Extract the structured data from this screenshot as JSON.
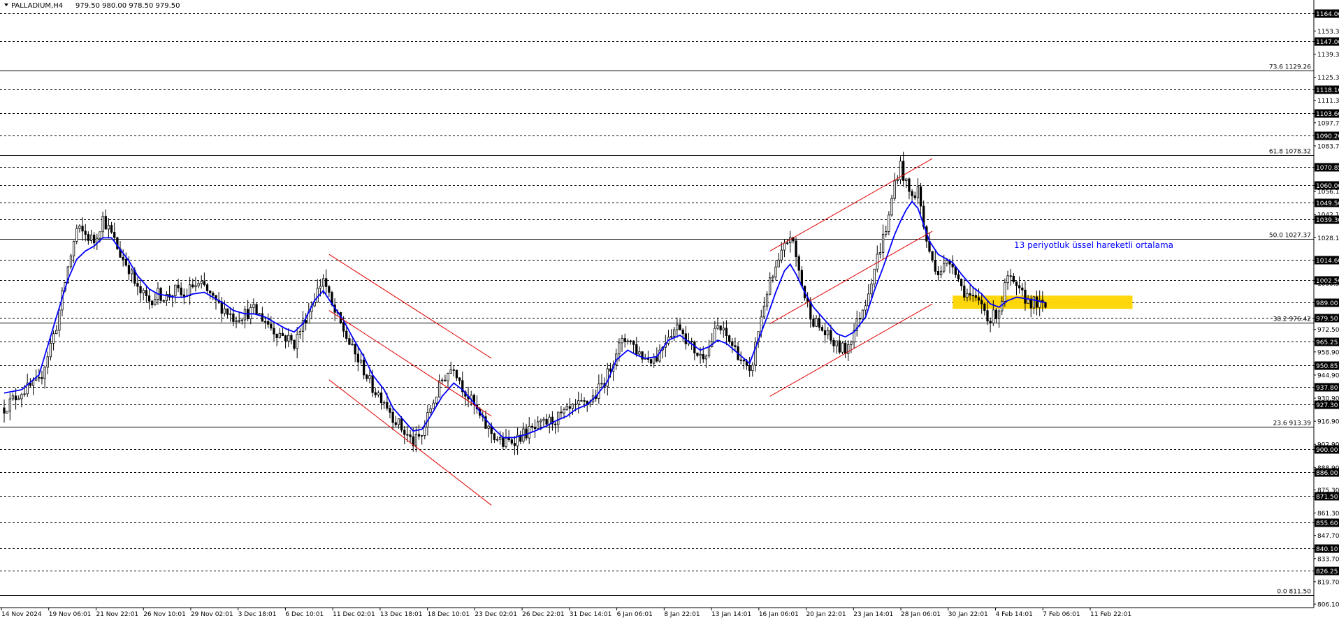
{
  "header": {
    "symbol": "PALLADIUM,H4",
    "ohlc": "979.50 980.00 978.50 979.50"
  },
  "annotation": {
    "ema_label": "13 periyotluk üssel hareketli ortalama"
  },
  "colors": {
    "ema": "#0000ff",
    "candle": "#000000",
    "channel": "#e00000",
    "zone": "#ffd500",
    "background": "#ffffff"
  },
  "chart_data": {
    "type": "candlestick",
    "instrument": "PALLADIUM",
    "timeframe": "H4",
    "ylim": [
      806.1,
      1167.0
    ],
    "y_tick_labels": [
      "1153.30",
      "1139.30",
      "1125.30",
      "1111.30",
      "1097.70",
      "1083.70",
      "1056.10",
      "1042.10",
      "1028.10",
      "1000.50",
      "972.50",
      "958.90",
      "944.90",
      "930.90",
      "916.90",
      "902.90",
      "888.90",
      "875.30",
      "861.30",
      "847.70",
      "833.70",
      "819.70",
      "806.10"
    ],
    "x_tick_labels": [
      "14 Nov 2024",
      "19 Nov 06:01",
      "21 Nov 22:01",
      "26 Nov 10:01",
      "29 Nov 02:01",
      "3 Dec 18:01",
      "6 Dec 10:01",
      "11 Dec 02:01",
      "13 Dec 18:01",
      "18 Dec 10:01",
      "23 Dec 02:01",
      "26 Dec 22:01",
      "31 Dec 14:01",
      "6 Jan 06:01",
      "8 Jan 22:01",
      "13 Jan 14:01",
      "16 Jan 06:01",
      "20 Jan 22:01",
      "23 Jan 14:01",
      "28 Jan 06:01",
      "30 Jan 22:01",
      "4 Feb 14:01",
      "7 Feb 06:01",
      "11 Feb 22:01"
    ],
    "levels": [
      {
        "label": "1164.00",
        "value": 1164.0,
        "boxed": true
      },
      {
        "label": "1147.00",
        "value": 1147.0,
        "boxed": true
      },
      {
        "label": "1118.10",
        "value": 1118.1,
        "boxed": true
      },
      {
        "label": "1103.60",
        "value": 1103.6,
        "boxed": true
      },
      {
        "label": "1090.20",
        "value": 1090.2,
        "boxed": true
      },
      {
        "label": "1070.85",
        "value": 1070.85,
        "boxed": true
      },
      {
        "label": "1060.00",
        "value": 1060.0,
        "boxed": true
      },
      {
        "label": "1049.50",
        "value": 1049.5,
        "boxed": true
      },
      {
        "label": "1039.30",
        "value": 1039.3,
        "boxed": true
      },
      {
        "label": "1014.60",
        "value": 1014.6,
        "boxed": true
      },
      {
        "label": "1002.50",
        "value": 1002.5,
        "boxed": true
      },
      {
        "label": "989.00",
        "value": 989.0,
        "boxed": true
      },
      {
        "label": "979.50",
        "value": 979.5,
        "boxed": true
      },
      {
        "label": "965.25",
        "value": 965.25,
        "boxed": true
      },
      {
        "label": "950.85",
        "value": 950.85,
        "boxed": true
      },
      {
        "label": "937.80",
        "value": 937.8,
        "boxed": true
      },
      {
        "label": "927.30",
        "value": 927.3,
        "boxed": true
      },
      {
        "label": "900.00",
        "value": 900.0,
        "boxed": true
      },
      {
        "label": "886.00",
        "value": 886.0,
        "boxed": true
      },
      {
        "label": "871.50",
        "value": 871.5,
        "boxed": true
      },
      {
        "label": "855.60",
        "value": 855.6,
        "boxed": true
      },
      {
        "label": "840.10",
        "value": 840.1,
        "boxed": true
      },
      {
        "label": "826.25",
        "value": 826.25,
        "boxed": true
      }
    ],
    "fibonacci": [
      {
        "label": "73.6 1129.26",
        "value": 1129.26
      },
      {
        "label": "61.8 1078.32",
        "value": 1078.32
      },
      {
        "label": "50.0 1027.37",
        "value": 1027.37
      },
      {
        "label": "38.2 976.42",
        "value": 976.42
      },
      {
        "label": "23.6 913.39",
        "value": 913.39
      },
      {
        "label": "0.0 811.50",
        "value": 811.5
      }
    ],
    "price_path": [
      [
        0,
        925
      ],
      [
        6,
        935
      ],
      [
        12,
        940
      ],
      [
        18,
        975
      ],
      [
        22,
        1010
      ],
      [
        25,
        1033
      ],
      [
        28,
        1030
      ],
      [
        31,
        1026
      ],
      [
        34,
        1040
      ],
      [
        37,
        1030
      ],
      [
        40,
        1018
      ],
      [
        43,
        1010
      ],
      [
        46,
        996
      ],
      [
        50,
        990
      ],
      [
        53,
        994
      ],
      [
        56,
        992
      ],
      [
        59,
        996
      ],
      [
        62,
        992
      ],
      [
        65,
        999
      ],
      [
        69,
        998
      ],
      [
        72,
        990
      ],
      [
        76,
        985
      ],
      [
        79,
        980
      ],
      [
        83,
        982
      ],
      [
        86,
        984
      ],
      [
        90,
        978
      ],
      [
        93,
        972
      ],
      [
        97,
        968
      ],
      [
        100,
        964
      ],
      [
        103,
        976
      ],
      [
        107,
        992
      ],
      [
        110,
        1004
      ],
      [
        113,
        986
      ],
      [
        117,
        972
      ],
      [
        120,
        960
      ],
      [
        124,
        948
      ],
      [
        127,
        937
      ],
      [
        131,
        930
      ],
      [
        134,
        920
      ],
      [
        138,
        910
      ],
      [
        141,
        904
      ],
      [
        144,
        908
      ],
      [
        147,
        925
      ],
      [
        151,
        942
      ],
      [
        155,
        951
      ],
      [
        158,
        938
      ],
      [
        162,
        926
      ],
      [
        165,
        916
      ],
      [
        169,
        908
      ],
      [
        172,
        903
      ],
      [
        176,
        906
      ],
      [
        180,
        910
      ],
      [
        183,
        912
      ],
      [
        187,
        916
      ],
      [
        190,
        918
      ],
      [
        194,
        922
      ],
      [
        197,
        925
      ],
      [
        201,
        928
      ],
      [
        204,
        933
      ],
      [
        208,
        945
      ],
      [
        211,
        960
      ],
      [
        215,
        968
      ],
      [
        218,
        960
      ],
      [
        221,
        955
      ],
      [
        225,
        956
      ],
      [
        229,
        970
      ],
      [
        233,
        975
      ],
      [
        236,
        964
      ],
      [
        240,
        956
      ],
      [
        243,
        962
      ],
      [
        246,
        974
      ],
      [
        249,
        968
      ],
      [
        253,
        958
      ],
      [
        257,
        944
      ],
      [
        260,
        972
      ],
      [
        263,
        996
      ],
      [
        266,
        1008
      ],
      [
        269,
        1022
      ],
      [
        271,
        1030
      ],
      [
        273,
        1016
      ],
      [
        276,
        992
      ],
      [
        279,
        978
      ],
      [
        283,
        970
      ],
      [
        287,
        962
      ],
      [
        290,
        960
      ],
      [
        293,
        972
      ],
      [
        297,
        990
      ],
      [
        300,
        1010
      ],
      [
        303,
        1028
      ],
      [
        305,
        1040
      ],
      [
        307,
        1062
      ],
      [
        309,
        1072
      ],
      [
        311,
        1060
      ],
      [
        313,
        1052
      ],
      [
        315,
        1058
      ],
      [
        317,
        1035
      ],
      [
        319,
        1018
      ],
      [
        322,
        1008
      ],
      [
        325,
        1012
      ],
      [
        327,
        1014
      ],
      [
        330,
        998
      ],
      [
        334,
        990
      ],
      [
        337,
        988
      ],
      [
        340,
        978
      ],
      [
        343,
        985
      ],
      [
        346,
        1004
      ],
      [
        349,
        996
      ],
      [
        353,
        990
      ],
      [
        356,
        988
      ],
      [
        358,
        986
      ]
    ],
    "ema13_path": [
      [
        0,
        934
      ],
      [
        6,
        936
      ],
      [
        12,
        945
      ],
      [
        18,
        980
      ],
      [
        22,
        1003
      ],
      [
        25,
        1015
      ],
      [
        28,
        1020
      ],
      [
        31,
        1023
      ],
      [
        34,
        1028
      ],
      [
        37,
        1028
      ],
      [
        40,
        1021
      ],
      [
        43,
        1014
      ],
      [
        46,
        1005
      ],
      [
        50,
        997
      ],
      [
        53,
        994
      ],
      [
        56,
        993
      ],
      [
        59,
        992
      ],
      [
        62,
        992
      ],
      [
        65,
        994
      ],
      [
        69,
        995
      ],
      [
        72,
        992
      ],
      [
        76,
        988
      ],
      [
        79,
        984
      ],
      [
        83,
        982
      ],
      [
        86,
        982
      ],
      [
        90,
        980
      ],
      [
        93,
        977
      ],
      [
        97,
        973
      ],
      [
        100,
        971
      ],
      [
        103,
        976
      ],
      [
        107,
        990
      ],
      [
        110,
        996
      ],
      [
        113,
        988
      ],
      [
        117,
        978
      ],
      [
        120,
        968
      ],
      [
        124,
        956
      ],
      [
        127,
        945
      ],
      [
        131,
        936
      ],
      [
        134,
        925
      ],
      [
        138,
        917
      ],
      [
        141,
        911
      ],
      [
        144,
        912
      ],
      [
        147,
        920
      ],
      [
        151,
        932
      ],
      [
        155,
        940
      ],
      [
        158,
        936
      ],
      [
        162,
        928
      ],
      [
        165,
        920
      ],
      [
        169,
        912
      ],
      [
        172,
        907
      ],
      [
        176,
        907
      ],
      [
        180,
        909
      ],
      [
        183,
        911
      ],
      [
        187,
        914
      ],
      [
        190,
        917
      ],
      [
        194,
        920
      ],
      [
        197,
        924
      ],
      [
        201,
        927
      ],
      [
        204,
        932
      ],
      [
        208,
        941
      ],
      [
        211,
        954
      ],
      [
        215,
        960
      ],
      [
        218,
        957
      ],
      [
        221,
        955
      ],
      [
        225,
        956
      ],
      [
        229,
        966
      ],
      [
        233,
        969
      ],
      [
        236,
        965
      ],
      [
        240,
        960
      ],
      [
        243,
        962
      ],
      [
        246,
        966
      ],
      [
        249,
        964
      ],
      [
        253,
        958
      ],
      [
        257,
        952
      ],
      [
        260,
        966
      ],
      [
        263,
        980
      ],
      [
        266,
        995
      ],
      [
        269,
        1008
      ],
      [
        271,
        1012
      ],
      [
        273,
        1006
      ],
      [
        276,
        995
      ],
      [
        279,
        986
      ],
      [
        283,
        978
      ],
      [
        287,
        970
      ],
      [
        290,
        968
      ],
      [
        293,
        971
      ],
      [
        297,
        980
      ],
      [
        300,
        996
      ],
      [
        303,
        1010
      ],
      [
        305,
        1020
      ],
      [
        307,
        1030
      ],
      [
        309,
        1038
      ],
      [
        311,
        1045
      ],
      [
        313,
        1050
      ],
      [
        315,
        1046
      ],
      [
        317,
        1036
      ],
      [
        319,
        1026
      ],
      [
        322,
        1018
      ],
      [
        325,
        1015
      ],
      [
        327,
        1013
      ],
      [
        330,
        1006
      ],
      [
        334,
        998
      ],
      [
        337,
        994
      ],
      [
        340,
        988
      ],
      [
        343,
        986
      ],
      [
        346,
        990
      ],
      [
        349,
        992
      ],
      [
        353,
        991
      ],
      [
        356,
        990
      ],
      [
        358,
        989
      ]
    ],
    "n_bars": 360,
    "channels": [
      {
        "from": [
          112,
          1018
        ],
        "to": [
          168,
          955
        ]
      },
      {
        "from": [
          112,
          984
        ],
        "to": [
          168,
          920
        ]
      },
      {
        "from": [
          112,
          942
        ],
        "to": [
          168,
          866
        ]
      },
      {
        "from": [
          264,
          1020
        ],
        "to": [
          320,
          1076
        ]
      },
      {
        "from": [
          264,
          976
        ],
        "to": [
          320,
          1032
        ]
      },
      {
        "from": [
          264,
          932
        ],
        "to": [
          320,
          988
        ]
      }
    ],
    "zone": {
      "x_from": 327,
      "x_to": 389,
      "y_from": 985,
      "y_to": 993
    }
  }
}
